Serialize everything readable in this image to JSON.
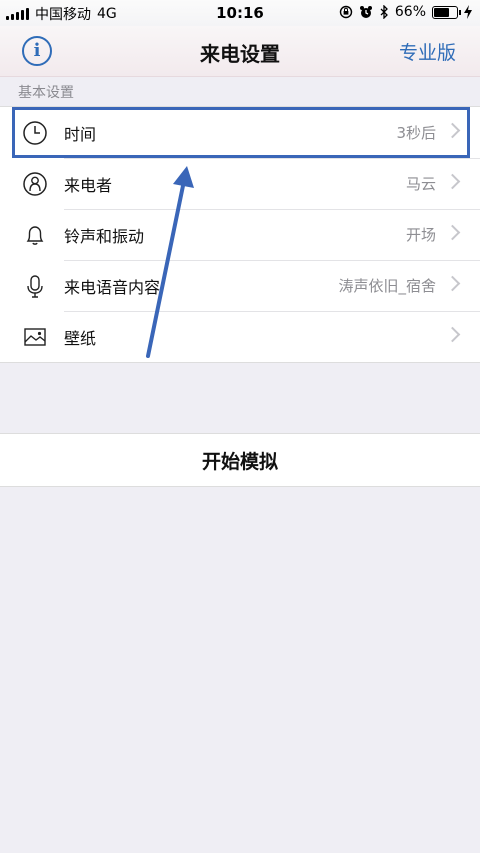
{
  "status_bar": {
    "carrier": "中国移动",
    "network": "4G",
    "time": "10:16",
    "battery_percent": "66%",
    "battery_level": 0.66
  },
  "nav": {
    "title": "来电设置",
    "pro_label": "专业版",
    "info_icon": "info-icon",
    "info_glyph": "i"
  },
  "section": {
    "header": "基本设置"
  },
  "settings": [
    {
      "label": "时间",
      "value": "3秒后",
      "icon": "clock-icon"
    },
    {
      "label": "来电者",
      "value": "马云",
      "icon": "person-icon"
    },
    {
      "label": "铃声和振动",
      "value": "开场",
      "icon": "bell-icon"
    },
    {
      "label": "来电语音内容",
      "value": "涛声依旧_宿舍",
      "icon": "microphone-icon"
    },
    {
      "label": "壁纸",
      "value": "",
      "icon": "image-icon"
    }
  ],
  "actions": {
    "start_label": "开始模拟"
  },
  "colors": {
    "accent": "#2f6cb8",
    "highlight": "#3a66b8"
  }
}
